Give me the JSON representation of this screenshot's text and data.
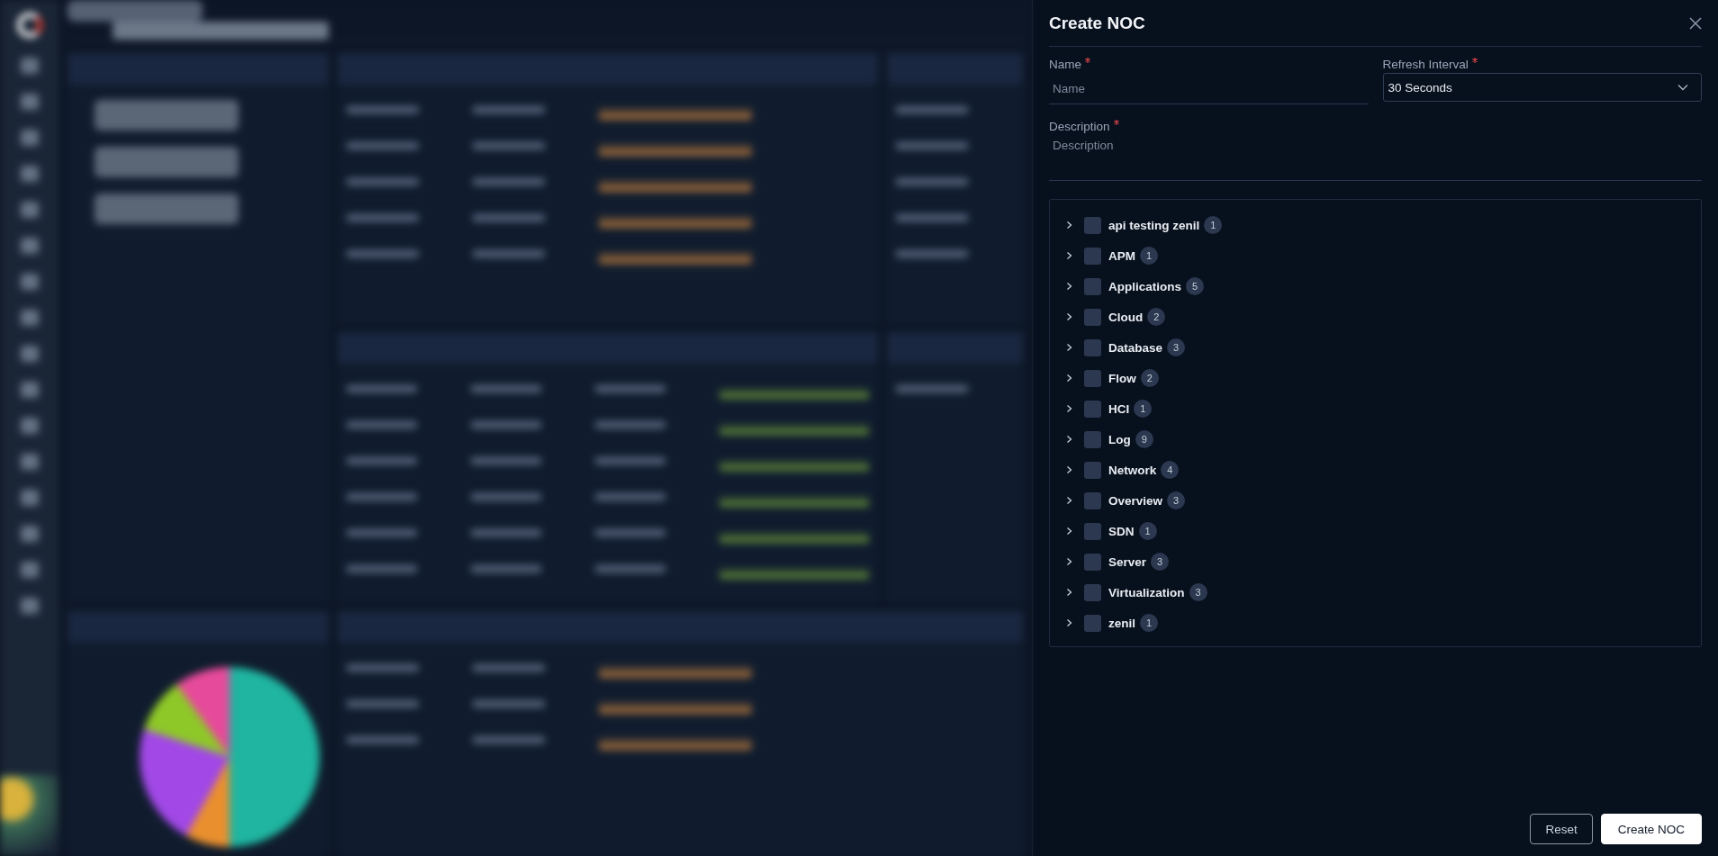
{
  "drawer": {
    "title": "Create NOC"
  },
  "form": {
    "name": {
      "label": "Name",
      "required": true,
      "placeholder": "Name"
    },
    "refresh_interval": {
      "label": "Refresh Interval",
      "required": true,
      "value": "30 Seconds"
    },
    "description": {
      "label": "Description",
      "required": true,
      "placeholder": "Description"
    }
  },
  "tree": [
    {
      "label": "api testing zenil",
      "count": "1",
      "checked": false,
      "expanded": false
    },
    {
      "label": "APM",
      "count": "1",
      "checked": false,
      "expanded": false
    },
    {
      "label": "Applications",
      "count": "5",
      "checked": false,
      "expanded": false
    },
    {
      "label": "Cloud",
      "count": "2",
      "checked": false,
      "expanded": false
    },
    {
      "label": "Database",
      "count": "3",
      "checked": false,
      "expanded": false
    },
    {
      "label": "Flow",
      "count": "2",
      "checked": false,
      "expanded": false
    },
    {
      "label": "HCI",
      "count": "1",
      "checked": false,
      "expanded": false
    },
    {
      "label": "Log",
      "count": "9",
      "checked": false,
      "expanded": false
    },
    {
      "label": "Network",
      "count": "4",
      "checked": false,
      "expanded": false
    },
    {
      "label": "Overview",
      "count": "3",
      "checked": false,
      "expanded": false
    },
    {
      "label": "SDN",
      "count": "1",
      "checked": false,
      "expanded": false
    },
    {
      "label": "Server",
      "count": "3",
      "checked": false,
      "expanded": false
    },
    {
      "label": "Virtualization",
      "count": "3",
      "checked": false,
      "expanded": false
    },
    {
      "label": "zenil",
      "count": "1",
      "checked": false,
      "expanded": false
    }
  ],
  "buttons": [
    {
      "label": "Reset",
      "kind": "secondary"
    },
    {
      "label": "Create NOC",
      "kind": "primary"
    }
  ]
}
